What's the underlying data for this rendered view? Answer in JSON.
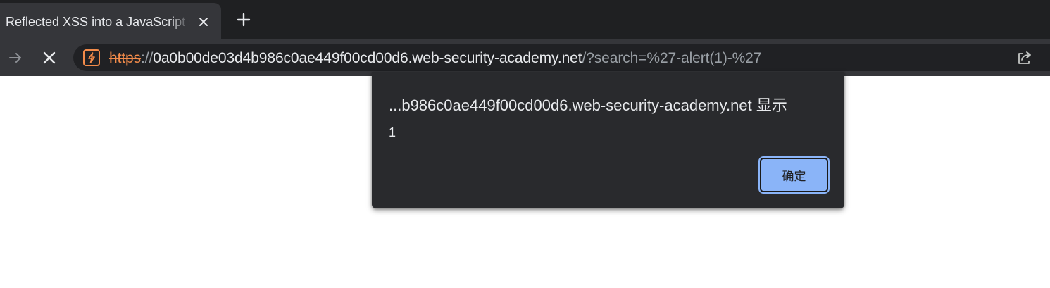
{
  "tab": {
    "title": "Reflected XSS into a JavaScript string with single quote and backslash escaped",
    "close_icon": "close-icon",
    "new_tab_icon": "plus-icon"
  },
  "toolbar": {
    "forward_icon": "arrow-right-icon",
    "stop_icon": "close-icon",
    "security_icon": "not-secure-warning-icon",
    "share_icon": "share-icon"
  },
  "address_bar": {
    "scheme": "https",
    "separator": "://",
    "host": "0a0b00de03d4b986c0ae449f00cd00d6.web-security-academy.net",
    "path": "/?search=%27-alert(1)-%27"
  },
  "dialog": {
    "title": "...b986c0ae449f00cd00d6.web-security-academy.net 显示",
    "message": "1",
    "ok_label": "确定"
  },
  "colors": {
    "tabstrip_bg": "#1f2022",
    "toolbar_bg": "#35363a",
    "omnibox_bg": "#202124",
    "not_secure": "#f28b4a",
    "dialog_bg": "#292a2d",
    "button_accent": "#8ab4f8"
  }
}
